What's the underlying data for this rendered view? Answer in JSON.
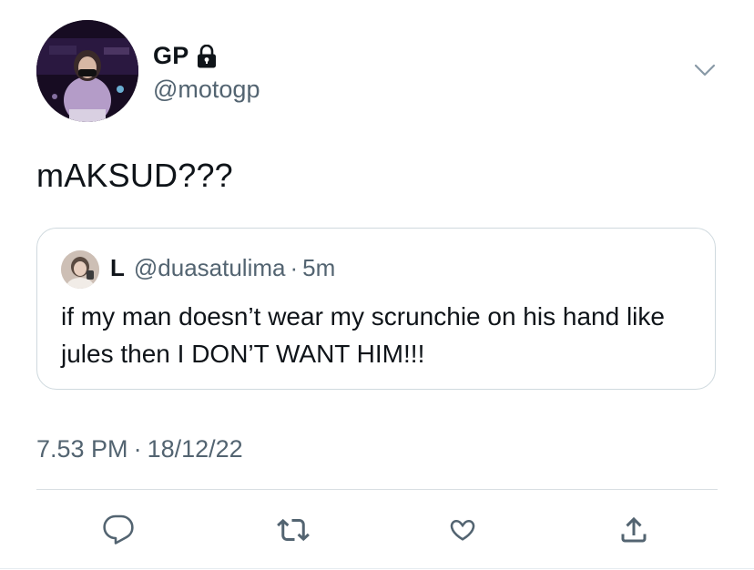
{
  "tweet": {
    "display_name": "GP",
    "handle": "@motogp",
    "text": "mAKSUD???",
    "timestamp_time": "7.53 PM",
    "timestamp_separator": "·",
    "timestamp_date": "18/12/22",
    "icons": {
      "lock": "lock-icon",
      "more": "chevron-down-icon"
    }
  },
  "quoted_tweet": {
    "display_name": "L",
    "handle": "@duasatulima",
    "separator": "·",
    "time_ago": "5m",
    "text": "if my man doesn’t wear my scrunchie on his hand like jules then I DON’T WANT HIM!!!"
  },
  "actions": [
    {
      "name": "reply",
      "icon": "reply-icon"
    },
    {
      "name": "retweet",
      "icon": "retweet-icon"
    },
    {
      "name": "like",
      "icon": "heart-icon"
    },
    {
      "name": "share",
      "icon": "share-icon"
    }
  ],
  "colors": {
    "text_primary": "#0f1419",
    "text_secondary": "#536471",
    "border": "#cfd9de",
    "icon": "#536471"
  }
}
